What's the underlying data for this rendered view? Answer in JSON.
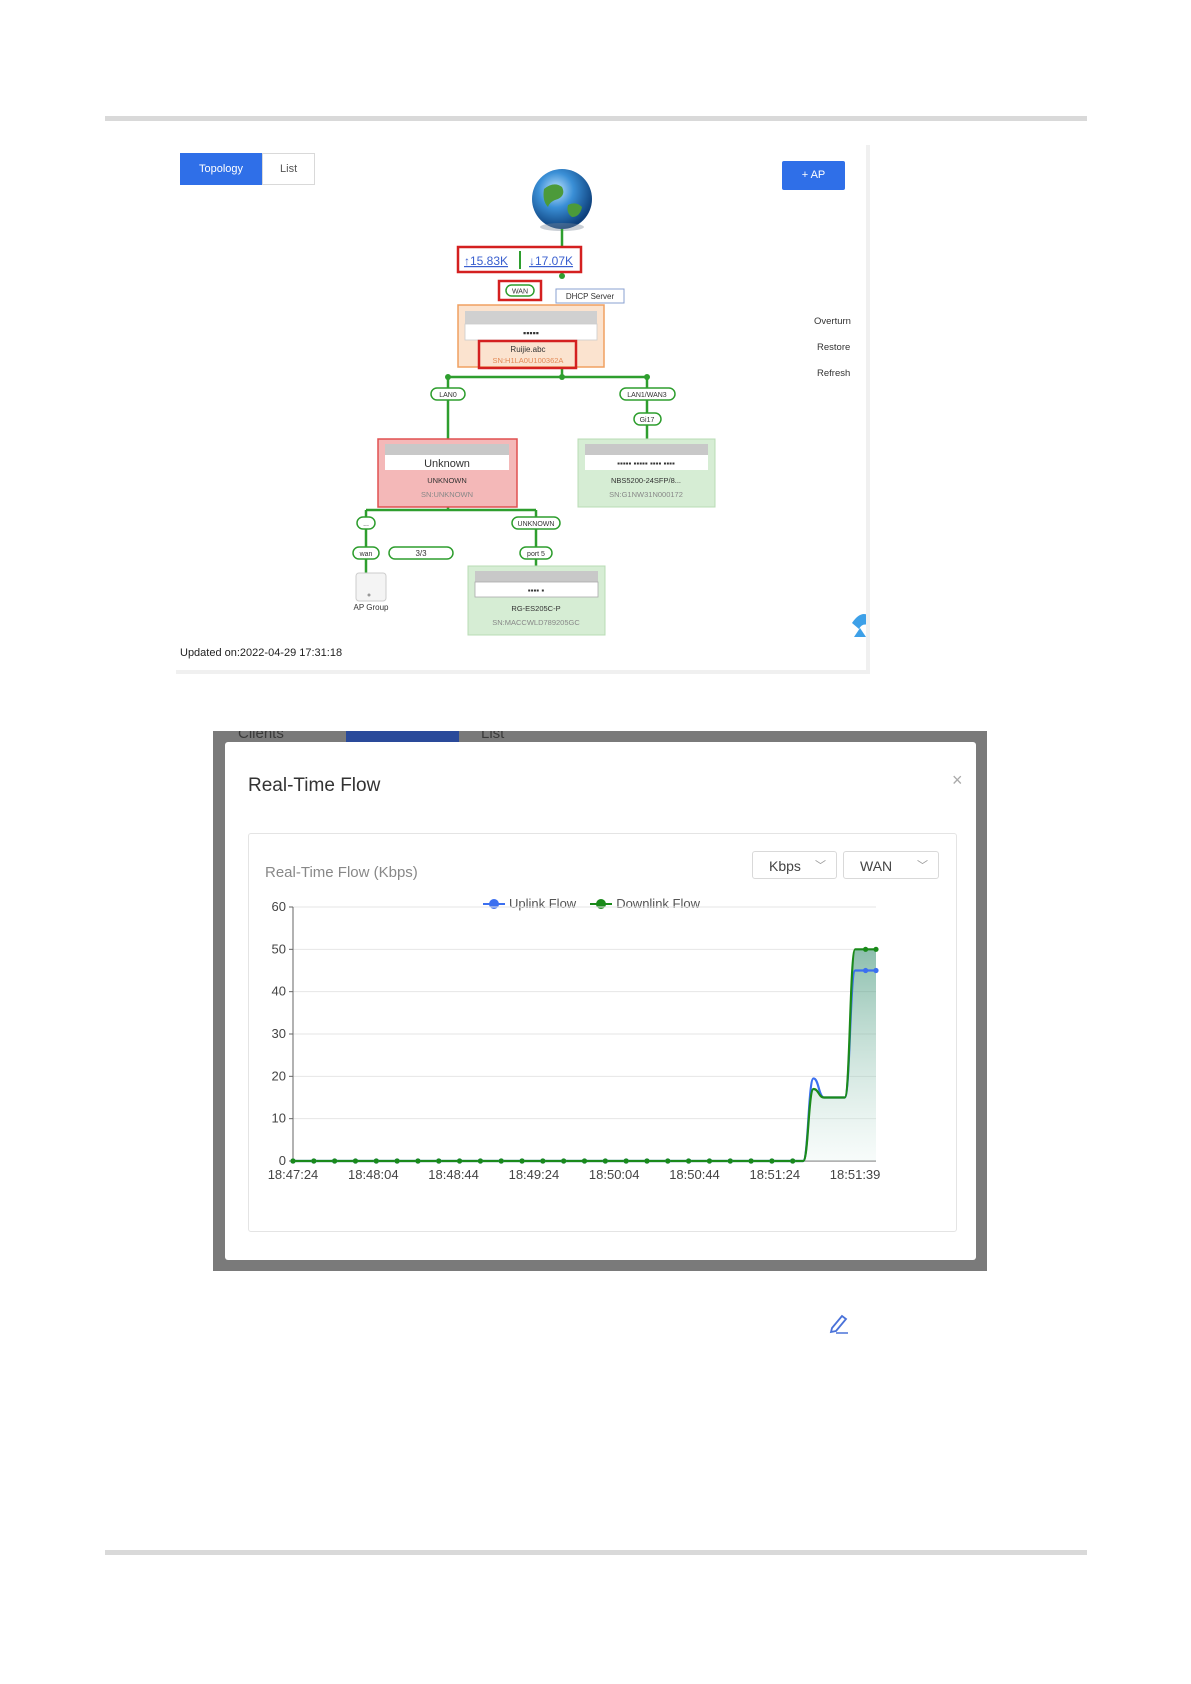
{
  "topology": {
    "tabs": [
      "Topology",
      "List"
    ],
    "add_ap_label": "+ AP",
    "uplink": "↑15.83K",
    "downlink": "↓17.07K",
    "wan_label": "WAN",
    "dhcp_label": "DHCP Server",
    "main_device": {
      "name": "Ruijie.abc",
      "sn": "SN:H1LA0U100362A"
    },
    "lan_labels": [
      "LAN0",
      "LAN1/WAN3"
    ],
    "port_labels": [
      "Gi17"
    ],
    "unknown_device": {
      "name": "Unknown",
      "model": "UNKNOWN",
      "sn": "SN:UNKNOWN"
    },
    "switch_device": {
      "model": "NBS5200-24SFP/8...",
      "sn": "SN:G1NW31N000172"
    },
    "sub_labels": [
      "...",
      "UNKNOWN",
      "wan",
      "3/3",
      "port 5"
    ],
    "ap_group_label": "AP Group",
    "es_device": {
      "model": "RG-ES205C-P",
      "sn": "SN:MACCWLD789205GC"
    },
    "side_actions": [
      "Overturn",
      "Restore",
      "Refresh"
    ],
    "updated": "Updated on:2022-04-29 17:31:18"
  },
  "flow_background": {
    "texts": [
      "Clients",
      "Topology",
      "List"
    ]
  },
  "flow": {
    "title": "Real-Time Flow",
    "close": "×",
    "panel_title": "Real-Time Flow (Kbps)",
    "unit_select": "Kbps",
    "interface_select": "WAN",
    "legend": [
      "Uplink Flow",
      "Downlink Flow"
    ],
    "colors": {
      "uplink": "#3b6ff0",
      "downlink": "#1a8a1a"
    }
  },
  "chart_data": {
    "type": "line",
    "title": "Real-Time Flow (Kbps)",
    "ylim": [
      0,
      60
    ],
    "yticks": [
      0,
      10,
      20,
      30,
      40,
      50,
      60
    ],
    "x_tick_labels": [
      "18:47:24",
      "18:48:04",
      "18:48:44",
      "18:49:24",
      "18:50:04",
      "18:50:44",
      "18:51:24",
      "18:51:39"
    ],
    "x": [
      0,
      5,
      10,
      15,
      20,
      25,
      30,
      35,
      40,
      45,
      50,
      55,
      60,
      65,
      70,
      75,
      80,
      85,
      90,
      95,
      100,
      105,
      110,
      115,
      120,
      125,
      130,
      135,
      140,
      145,
      150,
      155,
      160,
      165,
      170,
      175,
      180,
      185,
      190,
      195,
      200,
      205,
      210,
      215,
      220,
      225,
      230,
      235,
      240,
      245,
      250,
      255,
      260,
      265,
      270,
      275,
      280,
      285,
      290,
      295
    ],
    "series": [
      {
        "name": "Uplink Flow",
        "values": [
          0,
          0,
          0,
          0,
          0,
          0,
          0,
          0,
          0,
          0,
          0,
          0,
          0,
          0,
          0,
          0,
          0,
          0,
          0,
          0,
          0,
          0,
          0,
          0,
          0,
          0,
          0,
          0,
          0,
          0,
          0,
          0,
          0,
          0,
          0,
          0,
          0,
          0,
          0,
          0,
          0,
          0,
          0,
          0,
          0,
          0,
          0,
          0,
          0,
          0,
          0,
          0,
          0,
          0,
          0,
          0,
          0,
          0,
          0,
          0,
          0,
          0,
          0,
          0,
          0,
          0,
          0,
          0,
          0,
          0,
          0,
          0,
          0,
          0,
          0,
          0,
          0,
          0,
          0,
          0,
          0,
          0,
          0,
          0,
          0,
          0,
          0,
          0,
          0,
          0,
          0,
          0,
          0,
          0,
          0,
          0,
          0,
          0,
          0,
          0,
          0,
          0,
          0,
          0,
          0,
          0,
          0,
          0,
          0,
          0,
          0,
          0,
          0,
          0,
          0,
          0,
          0,
          0,
          0,
          0,
          0,
          0,
          0,
          0,
          0,
          0,
          0,
          0,
          0,
          0,
          0,
          0,
          0,
          0,
          0,
          0,
          0,
          0,
          0,
          0,
          0,
          0,
          0,
          0,
          0,
          0,
          0,
          0,
          0,
          0,
          0,
          0,
          0,
          0,
          0,
          0,
          0,
          0,
          0,
          0,
          0,
          0,
          0,
          0,
          0,
          0,
          0,
          0,
          0,
          0,
          0,
          0,
          0,
          0,
          0,
          0,
          0,
          0,
          0,
          0,
          0,
          0,
          0,
          0,
          0,
          0,
          0,
          0,
          0,
          0,
          0,
          0,
          0,
          0,
          0,
          0,
          0,
          0,
          0,
          0,
          0,
          0,
          0,
          0,
          0,
          0,
          0,
          0,
          0,
          0,
          0,
          0,
          0,
          0,
          0,
          0,
          0,
          0,
          0,
          0,
          0,
          0,
          0,
          0,
          0,
          0,
          0,
          0,
          0,
          0,
          0,
          0,
          0,
          0,
          0,
          0,
          0,
          0,
          0,
          0,
          0,
          0,
          0,
          0,
          0,
          0,
          0,
          0,
          0,
          0,
          0,
          0,
          0,
          0,
          0,
          0,
          0,
          0,
          0,
          0,
          0,
          0,
          0,
          0,
          0,
          0,
          0,
          0,
          0,
          0,
          0,
          0,
          0,
          0,
          0,
          0,
          0,
          0,
          0,
          0,
          0,
          0,
          0,
          0,
          0,
          0,
          0,
          0,
          0,
          0
        ]
      },
      {
        "name": "Downlink Flow",
        "values": []
      }
    ],
    "points": {
      "uplink": [
        [
          0,
          0
        ],
        [
          5,
          0
        ],
        [
          10,
          0
        ],
        [
          15,
          0
        ],
        [
          20,
          0
        ],
        [
          25,
          0
        ],
        [
          30,
          0
        ],
        [
          35,
          0
        ],
        [
          40,
          0
        ],
        [
          45,
          0
        ],
        [
          50,
          0
        ],
        [
          55,
          0
        ],
        [
          60,
          0
        ],
        [
          65,
          0
        ],
        [
          70,
          0
        ],
        [
          75,
          0
        ],
        [
          80,
          0
        ],
        [
          85,
          0
        ],
        [
          90,
          0
        ],
        [
          95,
          0
        ],
        [
          100,
          0
        ],
        [
          105,
          0
        ],
        [
          110,
          0
        ],
        [
          115,
          0
        ],
        [
          120,
          0
        ],
        [
          125,
          0
        ],
        [
          130,
          0
        ],
        [
          135,
          0
        ],
        [
          140,
          0
        ],
        [
          145,
          0
        ],
        [
          150,
          0
        ],
        [
          155,
          0
        ],
        [
          160,
          0
        ],
        [
          165,
          0
        ],
        [
          170,
          0
        ],
        [
          175,
          0
        ],
        [
          180,
          0
        ],
        [
          185,
          0
        ],
        [
          190,
          0
        ],
        [
          195,
          0
        ],
        [
          200,
          0
        ],
        [
          205,
          0
        ],
        [
          210,
          0
        ],
        [
          215,
          0
        ],
        [
          220,
          0
        ],
        [
          225,
          0
        ],
        [
          230,
          0
        ],
        [
          235,
          0
        ],
        [
          240,
          0
        ],
        [
          245,
          0
        ],
        [
          250,
          19.5
        ],
        [
          255,
          15
        ],
        [
          260,
          15
        ],
        [
          265,
          15
        ],
        [
          270,
          45
        ],
        [
          275,
          45
        ],
        [
          280,
          45
        ]
      ],
      "downlink": [
        [
          0,
          0
        ],
        [
          5,
          0
        ],
        [
          10,
          0
        ],
        [
          15,
          0
        ],
        [
          20,
          0
        ],
        [
          25,
          0
        ],
        [
          30,
          0
        ],
        [
          35,
          0
        ],
        [
          40,
          0
        ],
        [
          45,
          0
        ],
        [
          50,
          0
        ],
        [
          55,
          0
        ],
        [
          60,
          0
        ],
        [
          65,
          0
        ],
        [
          70,
          0
        ],
        [
          75,
          0
        ],
        [
          80,
          0
        ],
        [
          85,
          0
        ],
        [
          90,
          0
        ],
        [
          95,
          0
        ],
        [
          100,
          0
        ],
        [
          105,
          0
        ],
        [
          110,
          0
        ],
        [
          115,
          0
        ],
        [
          120,
          0
        ],
        [
          125,
          0
        ],
        [
          130,
          0
        ],
        [
          135,
          0
        ],
        [
          140,
          0
        ],
        [
          145,
          0
        ],
        [
          150,
          0
        ],
        [
          155,
          0
        ],
        [
          160,
          0
        ],
        [
          165,
          0
        ],
        [
          170,
          0
        ],
        [
          175,
          0
        ],
        [
          180,
          0
        ],
        [
          185,
          0
        ],
        [
          190,
          0
        ],
        [
          195,
          0
        ],
        [
          200,
          0
        ],
        [
          205,
          0
        ],
        [
          210,
          0
        ],
        [
          215,
          0
        ],
        [
          220,
          0
        ],
        [
          225,
          0
        ],
        [
          230,
          0
        ],
        [
          235,
          0
        ],
        [
          240,
          0
        ],
        [
          245,
          0
        ],
        [
          250,
          17
        ],
        [
          255,
          15
        ],
        [
          260,
          15
        ],
        [
          265,
          15
        ],
        [
          270,
          50
        ],
        [
          275,
          50
        ],
        [
          280,
          50
        ]
      ]
    },
    "grid": true,
    "legend_position": "top"
  }
}
